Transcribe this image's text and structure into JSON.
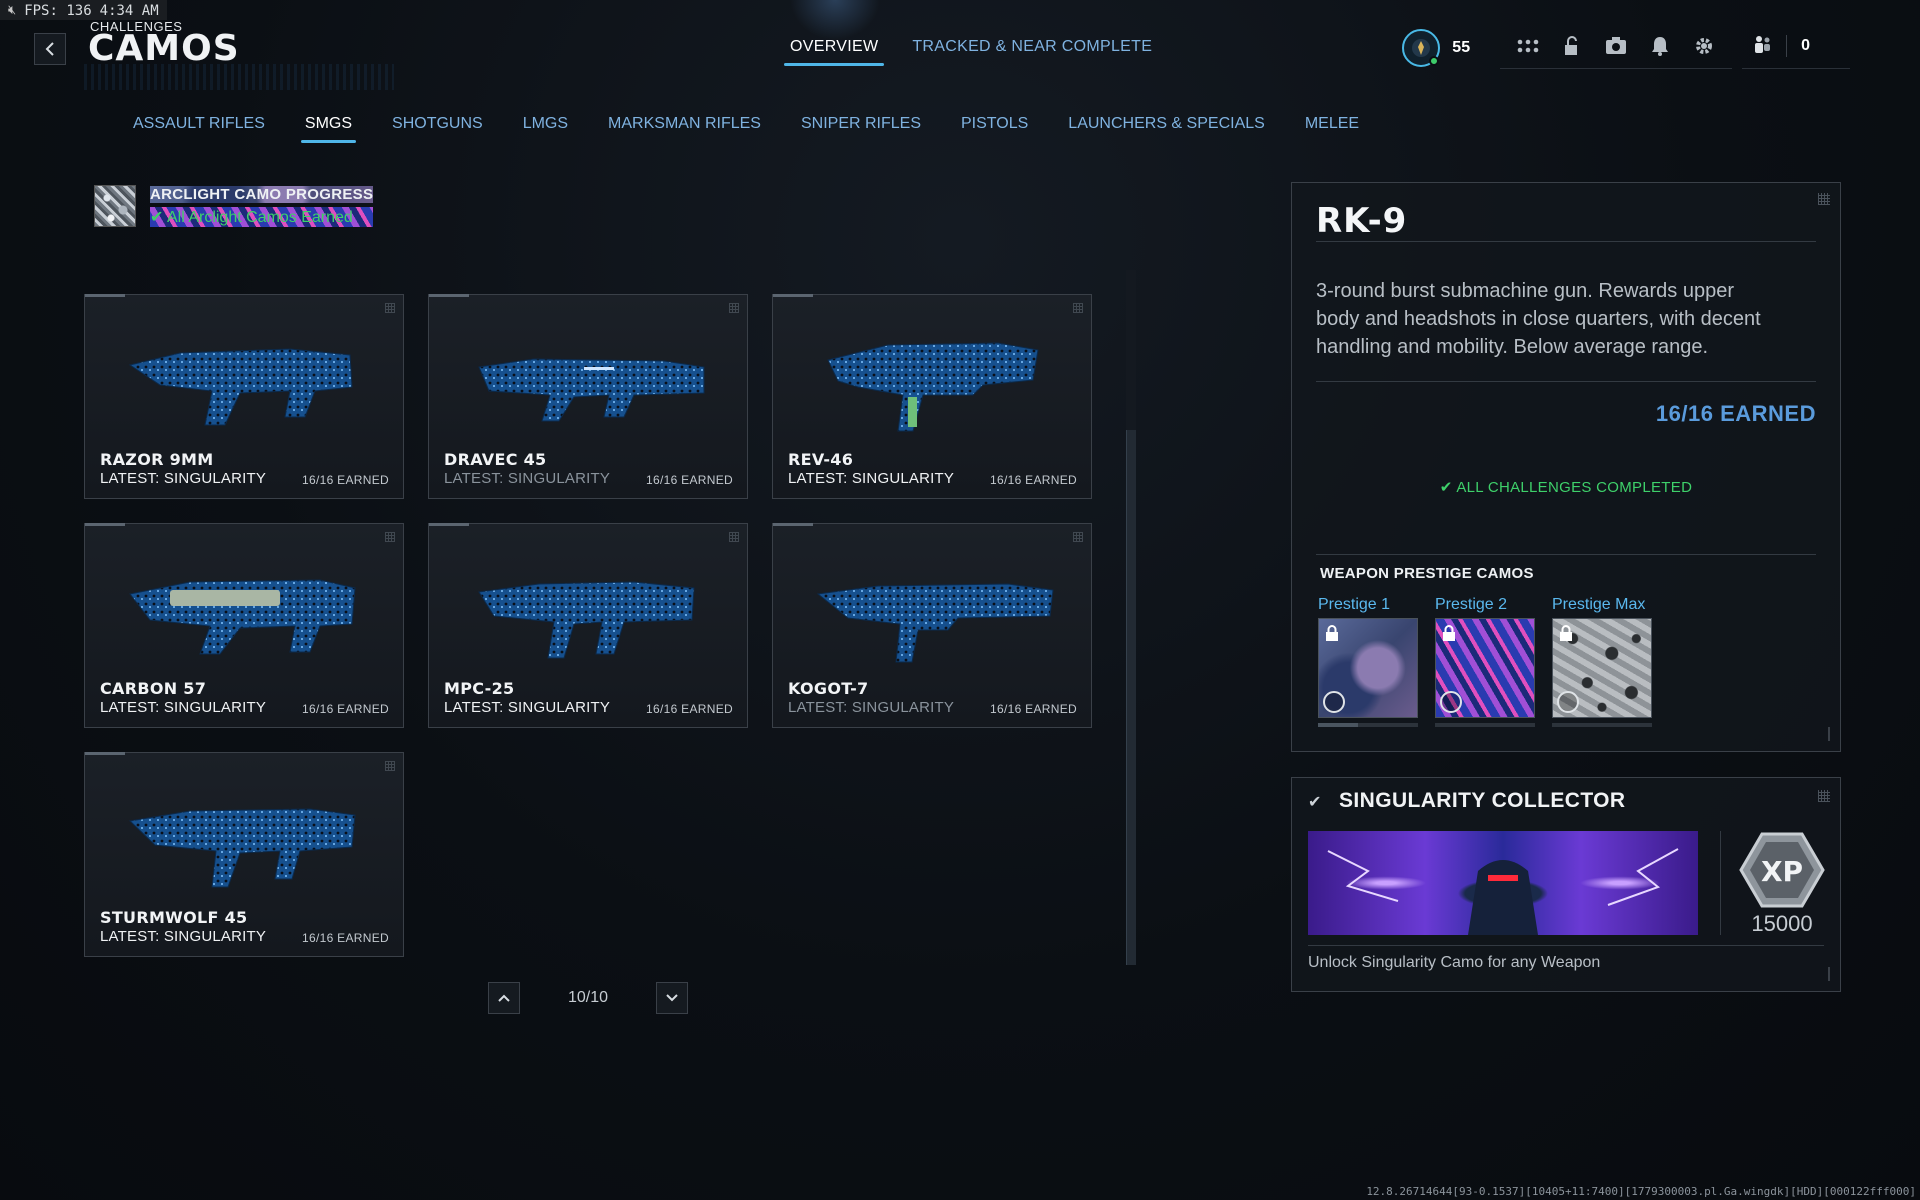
{
  "overlay": {
    "fps": "FPS: 136",
    "time": "4:34 AM"
  },
  "header": {
    "subtitle": "CHALLENGES",
    "title": "CAMOS"
  },
  "top_tabs": [
    {
      "label": "OVERVIEW",
      "active": true
    },
    {
      "label": "TRACKED & NEAR COMPLETE",
      "active": false
    }
  ],
  "status": {
    "level": "55",
    "party_count": "0"
  },
  "category_tabs": [
    {
      "label": "ASSAULT RIFLES"
    },
    {
      "label": "SMGS"
    },
    {
      "label": "SHOTGUNS"
    },
    {
      "label": "LMGS"
    },
    {
      "label": "MARKSMAN RIFLES"
    },
    {
      "label": "SNIPER RIFLES"
    },
    {
      "label": "PISTOLS"
    },
    {
      "label": "LAUNCHERS & SPECIALS"
    },
    {
      "label": "MELEE"
    }
  ],
  "arclight": {
    "title": "ARCLIGHT CAMO PROGRESS",
    "status": "All Arclight Camos Earned"
  },
  "weapons": [
    {
      "name": "RAZOR 9MM",
      "latest": "LATEST: SINGULARITY",
      "earned": "16/16 EARNED",
      "dim": false
    },
    {
      "name": "DRAVEC 45",
      "latest": "LATEST: SINGULARITY",
      "earned": "16/16 EARNED",
      "dim": true
    },
    {
      "name": "REV-46",
      "latest": "LATEST: SINGULARITY",
      "earned": "16/16 EARNED",
      "dim": false
    },
    {
      "name": "CARBON 57",
      "latest": "LATEST: SINGULARITY",
      "earned": "16/16 EARNED",
      "dim": false
    },
    {
      "name": "MPC-25",
      "latest": "LATEST: SINGULARITY",
      "earned": "16/16 EARNED",
      "dim": false
    },
    {
      "name": "KOGOT-7",
      "latest": "LATEST: SINGULARITY",
      "earned": "16/16 EARNED",
      "dim": true
    },
    {
      "name": "STURMWOLF 45",
      "latest": "LATEST: SINGULARITY",
      "earned": "16/16 EARNED",
      "dim": false
    }
  ],
  "pager": {
    "page": "10/10"
  },
  "detail": {
    "name": "RK-9",
    "description": "3-round burst submachine gun. Rewards upper body and headshots in close quarters, with decent handling and mobility. Below average range.",
    "earned": "16/16 EARNED",
    "completed": "ALL CHALLENGES COMPLETED",
    "prestige_title": "WEAPON PRESTIGE CAMOS",
    "prestige": [
      {
        "label": "Prestige 1",
        "progress": 0.4
      },
      {
        "label": "Prestige 2",
        "progress": 0.0
      },
      {
        "label": "Prestige Max",
        "progress": 0.0
      }
    ]
  },
  "collector": {
    "title": "SINGULARITY COLLECTOR",
    "xp_label": "XP",
    "xp_value": "15000",
    "description": "Unlock Singularity Camo for any Weapon"
  },
  "build_info": "12.8.26714644[93-0.1537][10405+11:7400][1779300003.pl.Ga.wingdk][HDD][000122fff000]",
  "colors": {
    "accent": "#4fb6e8",
    "tab_text": "#7fb2e0",
    "success": "#3ed06a",
    "earned_blue": "#5a9bdc",
    "camo_blue": "#1b5fa8"
  }
}
